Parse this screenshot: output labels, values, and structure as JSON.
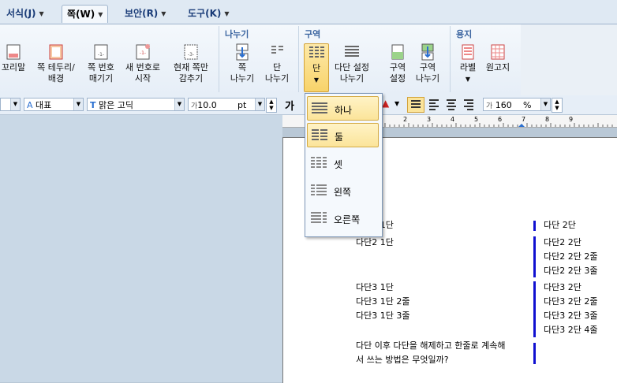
{
  "menu": {
    "tabs": [
      {
        "label": "서식(J)"
      },
      {
        "label": "쪽(W)"
      },
      {
        "label": "보안(R)"
      },
      {
        "label": "도구(K)"
      }
    ]
  },
  "ribbon": {
    "groups": {
      "break": "나누기",
      "section": "구역",
      "paper": "용지"
    },
    "buttons": {
      "footer": [
        "꼬리말",
        ""
      ],
      "border": [
        "쪽 테두리/",
        "배경"
      ],
      "page_number": [
        "쪽 번호",
        "매기기"
      ],
      "new_number": [
        "새 번호로",
        "시작"
      ],
      "hide_current": [
        "현재 쪽만",
        "감추기"
      ],
      "page_break": [
        "쪽",
        "나누기"
      ],
      "column_break": [
        "단",
        "나누기"
      ],
      "columns": [
        "단",
        ""
      ],
      "multi_column": [
        "다단 설정",
        "나누기"
      ],
      "section_settings": [
        "구역",
        "설정"
      ],
      "section_break": [
        "구역",
        "나누기"
      ],
      "label": [
        "라벨",
        ""
      ],
      "manuscript": [
        "원고지",
        ""
      ]
    }
  },
  "format": {
    "style_value": "대표",
    "font_value": "맑은 고딕",
    "size_value": "10.0",
    "size_unit": "pt",
    "bold": "가",
    "line_spacing": "160",
    "line_unit": "%"
  },
  "dropdown": {
    "items": [
      {
        "label": "하나"
      },
      {
        "label": "둘"
      },
      {
        "label": "셋"
      },
      {
        "label": "왼쪽"
      },
      {
        "label": "오른쪽"
      }
    ]
  },
  "document": {
    "left": {
      "l1": "다단1 1단",
      "l2": "다단2 1단",
      "l3": "다단3 1단",
      "l4": "다단3 1단 2줄",
      "l5": "다단3 1단 3줄",
      "l6": "다단 이후 다단을 해제하고 한줄로 계속해",
      "l7": "서 쓰는 방법은 무엇일까?"
    },
    "right": {
      "r1": "다단 2단",
      "r2": "다단2 2단",
      "r3": "다단2 2단 2줄",
      "r4": "다단2 2단 3줄",
      "r5": "다단3 2단",
      "r6": "다단3 2단 2줄",
      "r7": "다단3 2단 3줄",
      "r8": "다단3 2단 4줄"
    }
  },
  "ruler_ticks": [
    "2",
    "3",
    "4",
    "5",
    "6",
    "7",
    "8",
    "9"
  ]
}
